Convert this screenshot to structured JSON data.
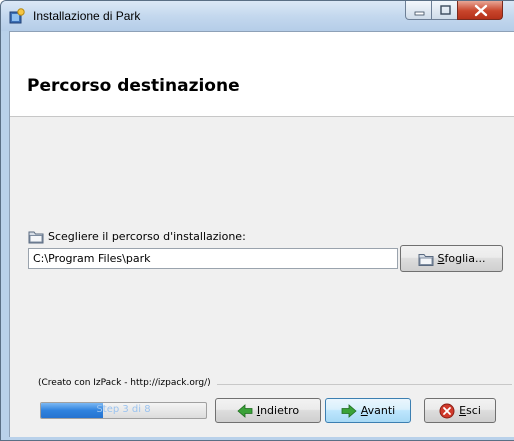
{
  "window": {
    "title": "Installazione di  Park"
  },
  "header": {
    "page_title": "Percorso destinazione"
  },
  "path": {
    "label": "Scegliere il percorso d'installazione:",
    "value": "C:\\Program Files\\park",
    "browse_label": "Sfoglia..."
  },
  "footer": {
    "credit": "(Creato con IzPack - http://izpack.org/)",
    "progress": {
      "text": "Step 3 di 8",
      "current": 3,
      "total": 8
    },
    "back_label": "Indietro",
    "next_label": "Avanti",
    "exit_label": "Esci"
  },
  "icons": {
    "app": "installer-icon",
    "folder": "folder-icon",
    "back": "arrow-left-icon",
    "next": "arrow-right-icon",
    "exit": "close-circle-icon"
  },
  "colors": {
    "window_frame": "#b9d1ea",
    "client_bg": "#f0f0f0",
    "progress_fill": "#2f82de",
    "close_button": "#c8452b",
    "arrow_green": "#3aa238"
  }
}
